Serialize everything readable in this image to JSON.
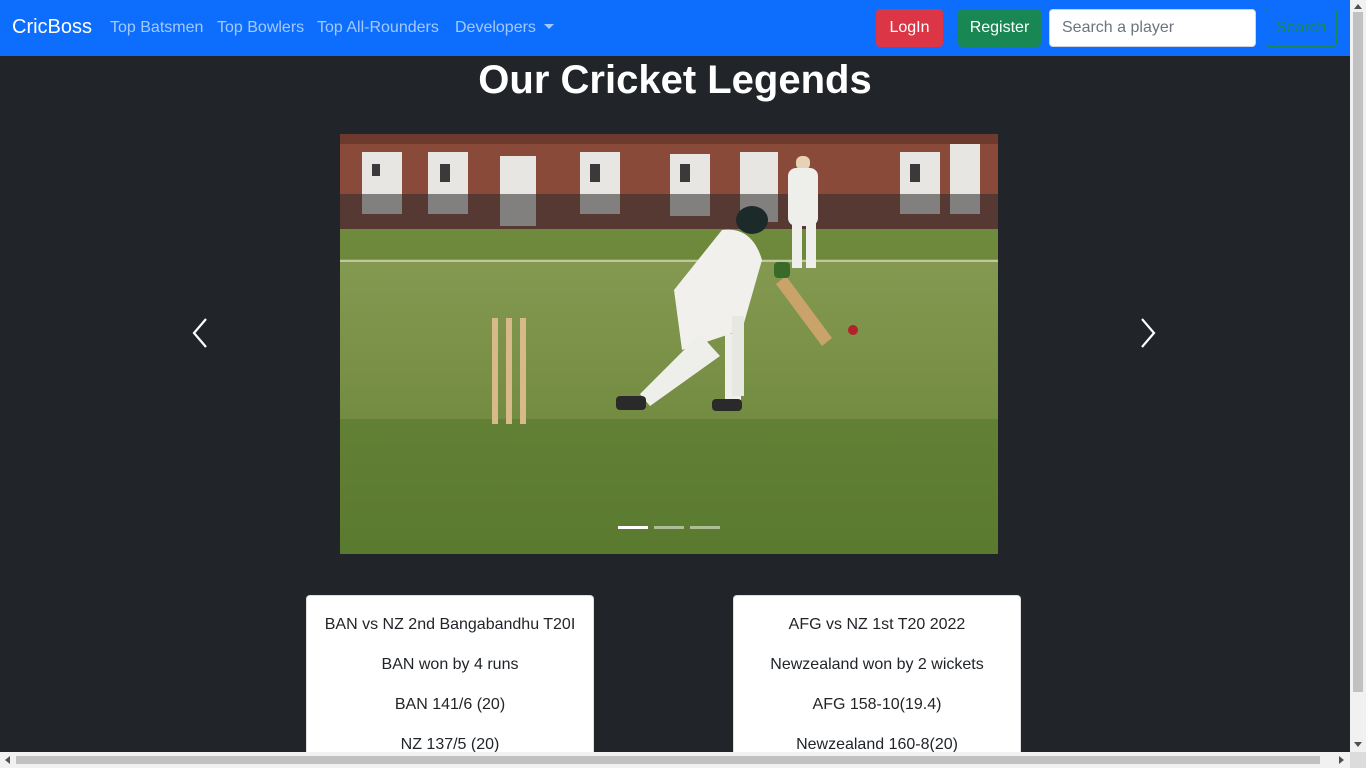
{
  "navbar": {
    "brand": "CricBoss",
    "links": [
      "Top Batsmen",
      "Top Bowlers",
      "Top All-Rounders"
    ],
    "dropdown": "Developers",
    "login_label": "LogIn",
    "register_label": "Register",
    "search_placeholder": "Search a player",
    "search_button": "Search",
    "colors": {
      "navbar_bg": "#0d6efd",
      "login": "#dc3545",
      "register": "#198754"
    }
  },
  "main": {
    "title": "Our Cricket Legends",
    "carousel": {
      "active_index": 0,
      "slide_count": 3,
      "image_alt": "batsman-playing-shot-photo"
    }
  },
  "cards": [
    {
      "match": "BAN vs NZ 2nd Bangabandhu T20I",
      "result": "BAN won by 4 runs",
      "score1": "BAN 141/6 (20)",
      "score2": "NZ 137/5 (20)"
    },
    {
      "match": "AFG vs NZ 1st T20 2022",
      "result": "Newzealand won by 2 wickets",
      "score1": "AFG 158-10(19.4)",
      "score2": "Newzealand 160-8(20)"
    }
  ],
  "page": {
    "background": "#212529"
  }
}
